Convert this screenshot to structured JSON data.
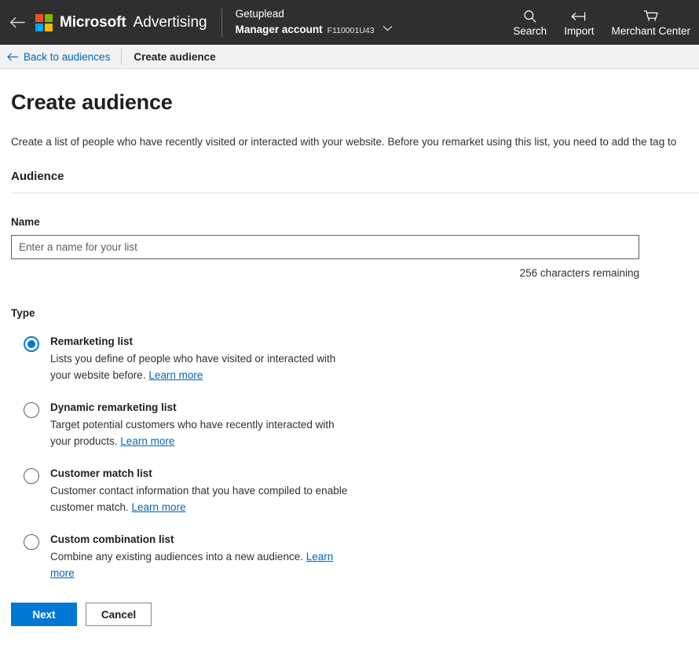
{
  "topbar": {
    "back_icon": "arrow-left-icon",
    "brand_microsoft": "Microsoft",
    "brand_product": "Advertising",
    "logo_colors": [
      "#f25022",
      "#7fba00",
      "#00a4ef",
      "#ffb900"
    ],
    "account": {
      "name": "Getuplead",
      "type": "Manager account",
      "id": "F110001U43",
      "chevron_icon": "chevron-down-icon"
    },
    "actions": [
      {
        "label": "Search",
        "icon": "search-icon"
      },
      {
        "label": "Import",
        "icon": "import-arrow-icon"
      },
      {
        "label": "Merchant Center",
        "icon": "shopping-cart-icon"
      }
    ]
  },
  "breadcrumb": {
    "back_label": "Back to audiences",
    "back_icon": "arrow-left-icon",
    "current": "Create audience",
    "link_color": "#0067b8"
  },
  "main": {
    "title": "Create audience",
    "description": "Create a list of people who have recently visited or interacted with your website. Before you remarket using this list, you need to add the tag to",
    "section_heading": "Audience",
    "name_field": {
      "label": "Name",
      "placeholder": "Enter a name for your list",
      "value": "",
      "char_count": "256 characters remaining"
    },
    "type_label": "Type",
    "selected_type": "Remarketing list",
    "options": [
      {
        "title": "Remarketing list",
        "description": "Lists you define of people who have visited or interacted with your website before. ",
        "link": "Learn more",
        "checked": true
      },
      {
        "title": "Dynamic remarketing list",
        "description": "Target potential customers who have recently interacted with your products. ",
        "link": "Learn more",
        "checked": false
      },
      {
        "title": "Customer match list",
        "description": "Customer contact information that you have compiled to enable customer match. ",
        "link": "Learn more",
        "checked": false
      },
      {
        "title": "Custom combination list",
        "description": "Combine any existing audiences into a new audience. ",
        "link": "Learn more",
        "checked": false
      }
    ],
    "buttons": {
      "next": "Next",
      "cancel": "Cancel",
      "primary_color": "#0078d4"
    }
  }
}
